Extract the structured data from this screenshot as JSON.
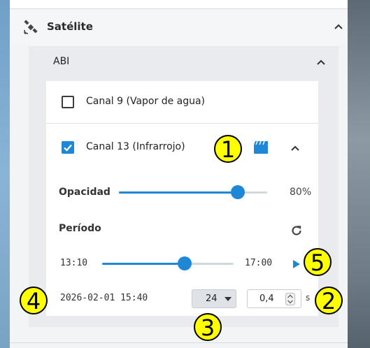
{
  "satellite": {
    "title": "Satélite"
  },
  "abi": {
    "title": "ABI"
  },
  "canal9": {
    "label": "Canal 9 (Vapor de agua)",
    "checked": false
  },
  "canal13": {
    "label": "Canal 13 (Infrarrojo)",
    "checked": true,
    "opacity": {
      "label": "Opacidad",
      "value_text": "80%",
      "value": 0.8
    },
    "period": {
      "label": "Período",
      "start": "13:10",
      "end": "17:00",
      "position": 0.63,
      "datetime": "2026-02-01 15:40",
      "frames_selected": "24",
      "interval_value": "0,4",
      "interval_unit": "s"
    }
  },
  "annotations": [
    "1",
    "2",
    "3",
    "4",
    "5"
  ],
  "colors": {
    "accent": "#1e88d6",
    "badge": "#ffff00"
  }
}
